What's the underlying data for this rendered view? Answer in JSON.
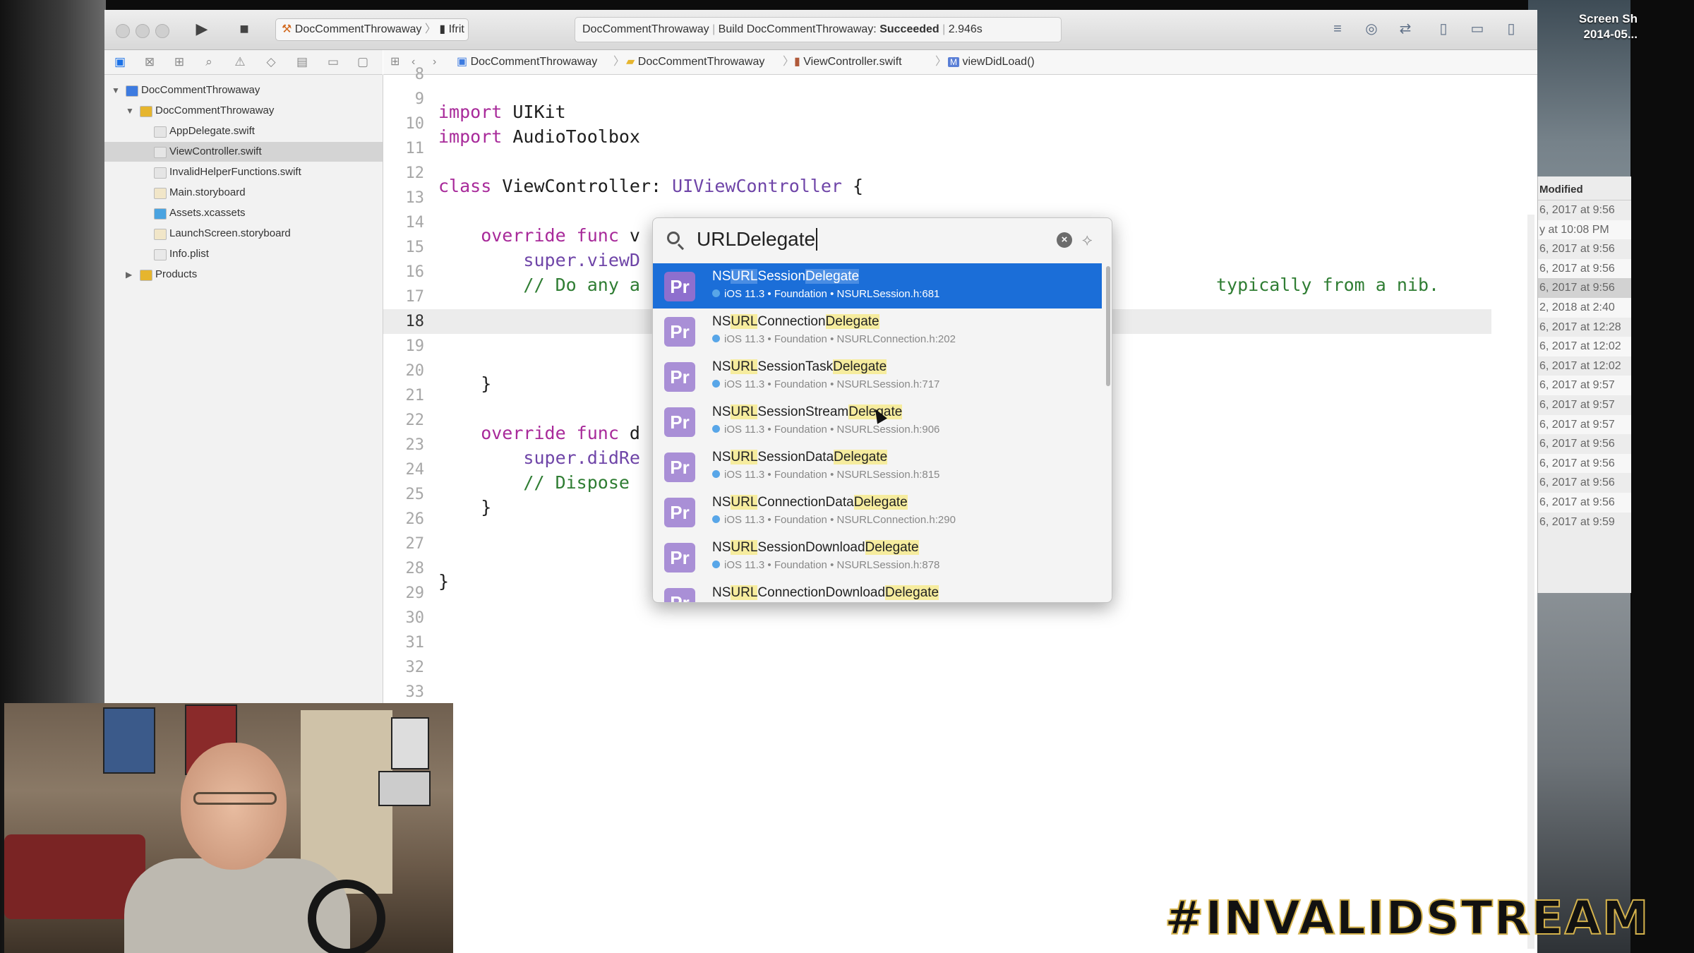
{
  "desktop": {
    "screenshot_label_line1": "Screen Sh",
    "screenshot_label_line2": "2014-05...",
    "finder_column_header": "Modified",
    "finder_rows": [
      "6, 2017 at 9:56",
      "y at 10:08 PM",
      "6, 2017 at 9:56",
      "6, 2017 at 9:56",
      "6, 2017 at 9:56",
      "2, 2018 at 2:40",
      "6, 2017 at 12:28",
      "6, 2017 at 12:02",
      "6, 2017 at 12:02",
      "6, 2017 at 9:57",
      "6, 2017 at 9:57",
      "6, 2017 at 9:57",
      "6, 2017 at 9:56",
      "6, 2017 at 9:56",
      "6, 2017 at 9:56",
      "6, 2017 at 9:56",
      "6, 2017 at 9:59"
    ]
  },
  "toolbar": {
    "scheme_project": "DocCommentThrowaway",
    "scheme_device": "Ifrit",
    "activity_project": "DocCommentThrowaway",
    "activity_prefix": "Build DocCommentThrowaway:",
    "activity_status": "Succeeded",
    "activity_time": "2.946s"
  },
  "navigator": {
    "items": [
      {
        "label": "DocCommentThrowaway",
        "kind": "project"
      },
      {
        "label": "DocCommentThrowaway",
        "kind": "folder"
      },
      {
        "label": "AppDelegate.swift",
        "kind": "swift"
      },
      {
        "label": "ViewController.swift",
        "kind": "swift"
      },
      {
        "label": "InvalidHelperFunctions.swift",
        "kind": "swift"
      },
      {
        "label": "Main.storyboard",
        "kind": "storyboard"
      },
      {
        "label": "Assets.xcassets",
        "kind": "assets"
      },
      {
        "label": "LaunchScreen.storyboard",
        "kind": "storyboard"
      },
      {
        "label": "Info.plist",
        "kind": "plist"
      },
      {
        "label": "Products",
        "kind": "folder"
      }
    ]
  },
  "jumpbar": {
    "crumbs": [
      "DocCommentThrowaway",
      "DocCommentThrowaway",
      "ViewController.swift",
      "viewDidLoad()"
    ]
  },
  "editor": {
    "line_numbers": [
      "8",
      "9",
      "10",
      "11",
      "12",
      "13",
      "14",
      "15",
      "16",
      "17",
      "18",
      "19",
      "20",
      "21",
      "22",
      "23",
      "24",
      "25",
      "26",
      "27",
      "28",
      "29",
      "30",
      "31",
      "32",
      "33"
    ],
    "current_line": "18",
    "code": {
      "l9_kw": "import",
      "l9_rest": " UIKit",
      "l10_kw": "import",
      "l10_rest": " AudioToolbox",
      "l12_kw": "class",
      "l12_name": " ViewController: ",
      "l12_type": "UIViewController",
      "l12_end": " {",
      "l14_kw": "    override func",
      "l14_rest": " v",
      "l15": "        super.viewD",
      "l16_left": "        // Do any a",
      "l16_right": "typically from a nib.",
      "l20": "    }",
      "l22_kw": "    override func",
      "l22_rest": " d",
      "l23": "        super.didRe",
      "l24": "        // Dispose",
      "l25": "    }",
      "l28": "}"
    }
  },
  "open_quickly": {
    "query": "URLDelegate",
    "results": [
      {
        "parts": [
          "NS",
          "URL",
          "Session",
          "Delegate"
        ],
        "sub": "iOS 11.3 • Foundation • NSURLSession.h:681",
        "selected": true
      },
      {
        "parts": [
          "NS",
          "URL",
          "Connection",
          "Delegate"
        ],
        "sub": "iOS 11.3 • Foundation • NSURLConnection.h:202"
      },
      {
        "parts": [
          "NS",
          "URL",
          "SessionTask",
          "Delegate"
        ],
        "sub": "iOS 11.3 • Foundation • NSURLSession.h:717"
      },
      {
        "parts": [
          "NS",
          "URL",
          "SessionStream",
          "Delegate"
        ],
        "sub": "iOS 11.3 • Foundation • NSURLSession.h:906"
      },
      {
        "parts": [
          "NS",
          "URL",
          "SessionData",
          "Delegate"
        ],
        "sub": "iOS 11.3 • Foundation • NSURLSession.h:815"
      },
      {
        "parts": [
          "NS",
          "URL",
          "ConnectionData",
          "Delegate"
        ],
        "sub": "iOS 11.3 • Foundation • NSURLConnection.h:290"
      },
      {
        "parts": [
          "NS",
          "URL",
          "SessionDownload",
          "Delegate"
        ],
        "sub": "iOS 11.3 • Foundation • NSURLSession.h:878"
      },
      {
        "parts": [
          "NS",
          "URL",
          "ConnectionDownload",
          "Delegate"
        ],
        "sub": ""
      }
    ],
    "badge": "Pr"
  },
  "overlay": {
    "stream_tag": "#INVALIDSTREAM"
  },
  "colors": {
    "selection_blue": "#1b6ed8",
    "keyword": "#a82a9a",
    "type": "#6f45a8",
    "comment": "#2f7d33"
  }
}
